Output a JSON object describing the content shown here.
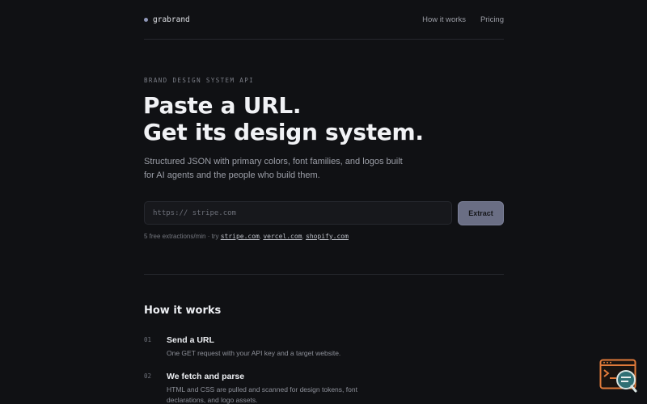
{
  "brand": {
    "name": "grabrand"
  },
  "nav": {
    "items": [
      "How it works",
      "Pricing"
    ]
  },
  "hero": {
    "eyebrow": "BRAND DESIGN SYSTEM API",
    "title_line1": "Paste a URL.",
    "title_line2": "Get its design system.",
    "subtitle": "Structured JSON with primary colors, font families, and logos built for AI agents and the people who build them."
  },
  "form": {
    "placeholder": "https:// stripe.com",
    "value": "",
    "submit_label": "Extract"
  },
  "hint": {
    "prefix": "5 free extractions/min · try ",
    "examples": [
      "stripe.com",
      "vercel.com",
      "shopify.com"
    ],
    "separator": ", "
  },
  "how_it_works": {
    "title": "How it works",
    "steps": [
      {
        "num": "01",
        "title": "Send a URL",
        "desc": "One GET request with your API key and a target website."
      },
      {
        "num": "02",
        "title": "We fetch and parse",
        "desc": "HTML and CSS are pulled and scanned for design tokens, font declarations, and logo assets."
      }
    ]
  },
  "widget": {
    "icon": "terminal-search-icon"
  },
  "colors": {
    "background": "#101114",
    "accent": "#6a6e84",
    "widget_orange": "#e07a3a",
    "widget_teal": "#2f6f74"
  }
}
